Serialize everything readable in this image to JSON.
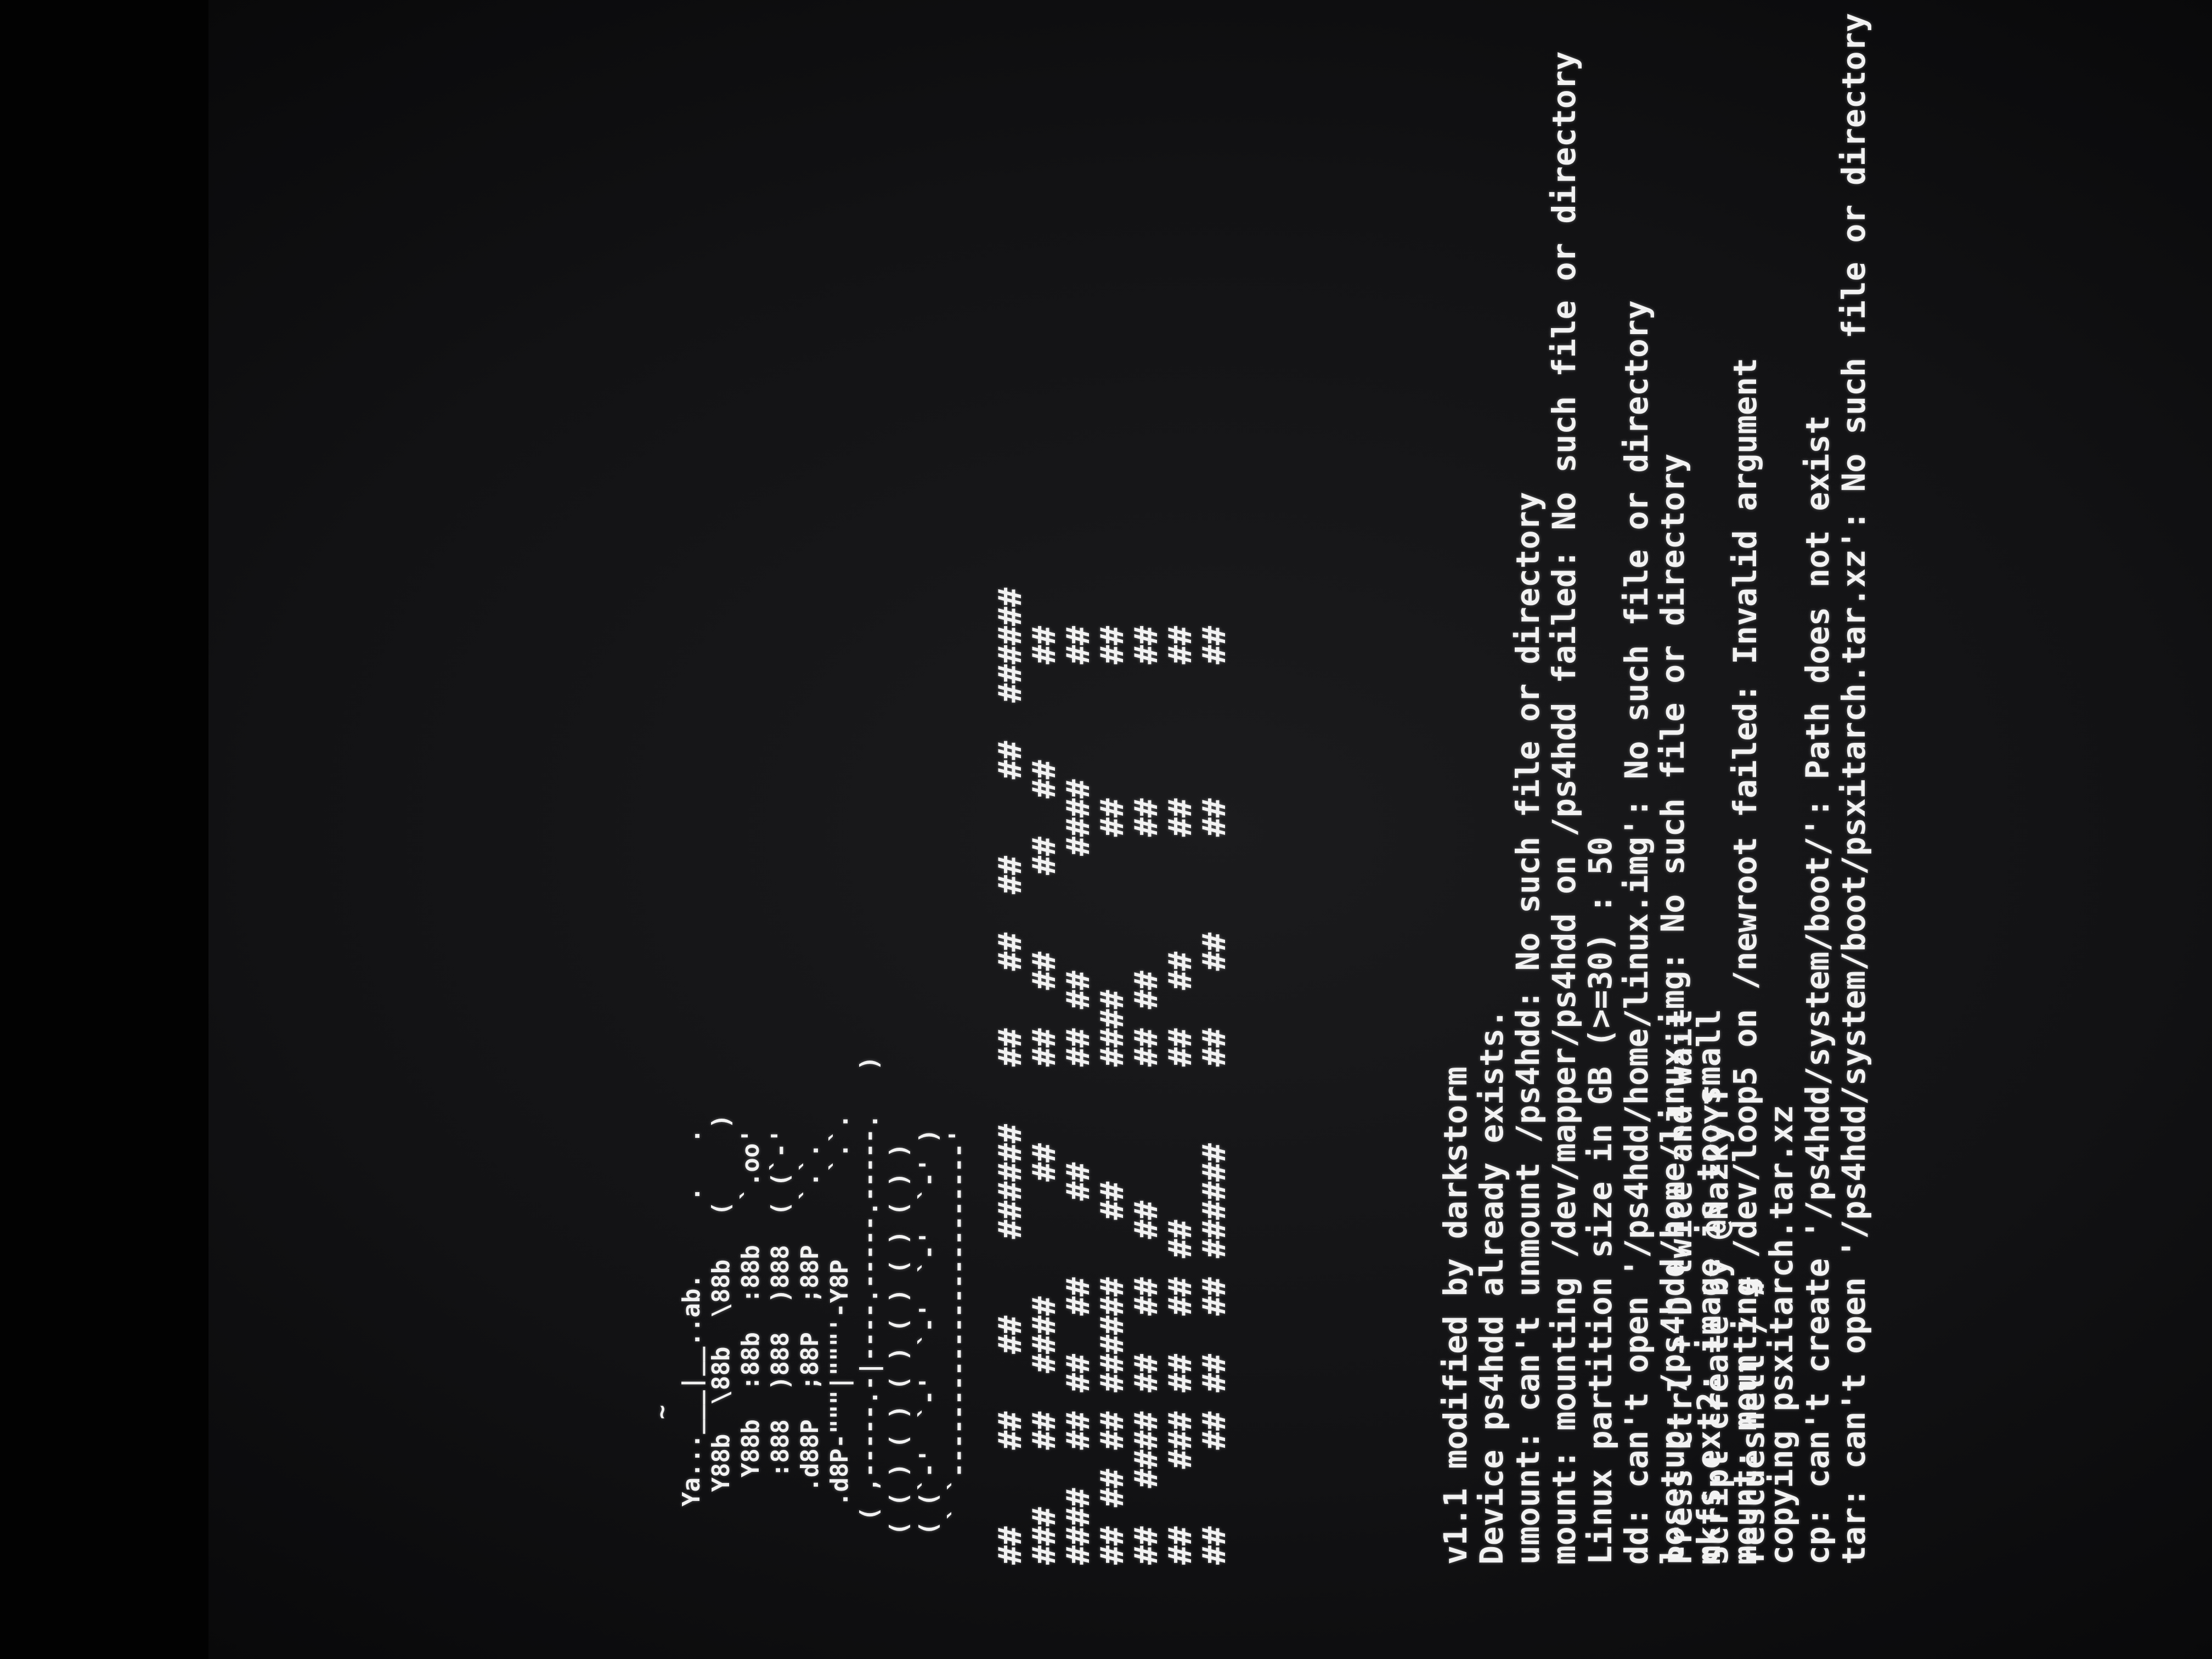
{
  "screen": {
    "ascii_art": "          ~\n    Ya...___|__..ab.     .   .\n     Y88b  \\88b  \\88b   (     )\n      Y88b  :88b  :88b   `.oo'\n      :888  )888  )888  ( (`-'\n     .d88P  ;88P  ;88P   `.`.\n    .d8P-\"\"\"|\"\"\"'-Y8P      `.`.\n   ( ,-----.-|----.-----.-----.   )\n  ( ( ) ( ) ( ) ( ) ( ) ( ) )\n  ( (`-'  `-'  `-'  `-'  `-' )\n   ` `-----------------------'",
    "banner": "##    ##   ##    ######   ##   ##  ##    ##  ######\n###   ##  ####      ##    ##  ##    ##  ##     ##\n####  ## ##  ##    ##     ## ##      ####      ##\n## ## ## ######   ##      ####        ##       ##\n##  #### ##  ##  ##       ## ##       ##       ##\n##   ### ##  ## ##        ##  ##      ##       ##\n##    ## ##  ## ######    ##   ##     ##       ##",
    "log_lines": "v1.1 modified by darkstorm\nDevice ps4hdd already exists.\numount: can't unmount /ps4hdd: No such file or directory\nmount: mounting /dev/mapper/ps4hdd on /ps4hdd failed: No such file or directory\nLinux partition size in GB (>=30) : 50\ndd: can't open '/ps4hdd/home/linux.img': No such file or directory\nlosetup: /ps4hdd/home/linux.img: No such file or directory\nmkfs.ext2: image is too small\nmount: mounting /dev/loop5 on /newroot failed: Invalid argument\ncopying psxitarch.tar.xz\ncp: can't create '/ps4hdd/system/boot/': Path does not exist\ntar: can't open '/ps4hdd/system/boot/psxitarch.tar.xz': No such file or directory",
    "tail_lines": "Press Ctrl + D twice and wait\nScript create by @NazkyYT\nrescueshell / #"
  },
  "colors": {
    "text": "#f2f2f2",
    "background": "#121214"
  }
}
